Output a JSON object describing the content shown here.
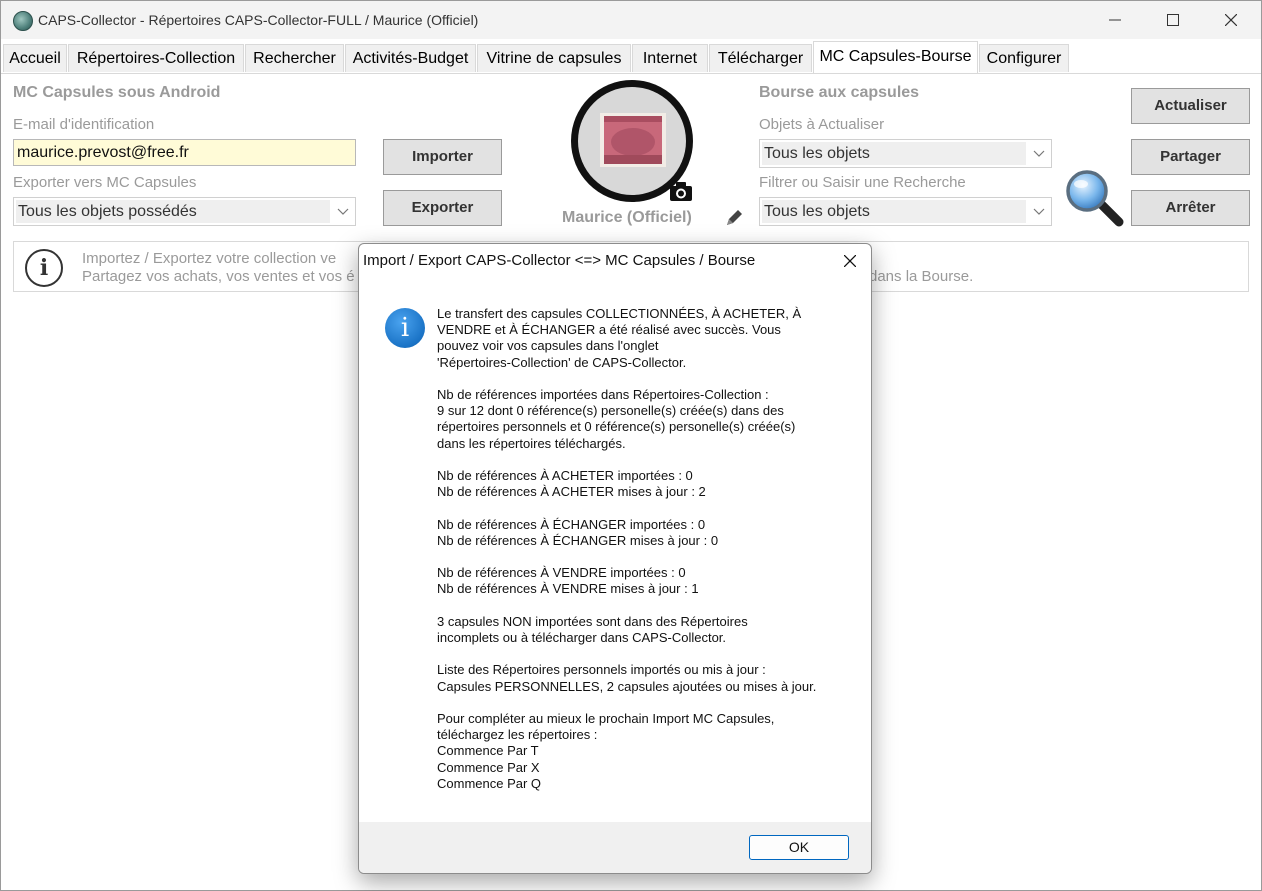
{
  "window": {
    "title": "CAPS-Collector - Répertoires CAPS-Collector-FULL / Maurice (Officiel)"
  },
  "tabs": [
    {
      "label": "Accueil"
    },
    {
      "label": "Répertoires-Collection"
    },
    {
      "label": "Rechercher"
    },
    {
      "label": "Activités-Budget"
    },
    {
      "label": "Vitrine de capsules"
    },
    {
      "label": "Internet"
    },
    {
      "label": "Télécharger"
    },
    {
      "label": "MC Capsules-Bourse",
      "active": true
    },
    {
      "label": "Configurer"
    }
  ],
  "left": {
    "heading": "MC Capsules sous Android",
    "email_label": "E-mail d'identification",
    "email_value": "maurice.prevost@free.fr",
    "export_label": "Exporter vers MC Capsules",
    "export_value": "Tous les objets possédés"
  },
  "buttons": {
    "import": "Importer",
    "export": "Exporter",
    "refresh": "Actualiser",
    "share": "Partager",
    "stop": "Arrêter"
  },
  "user": {
    "name": "Maurice (Officiel)"
  },
  "right": {
    "heading": "Bourse aux capsules",
    "objects_label": "Objets à Actualiser",
    "objects_value": "Tous les objets",
    "filter_label": "Filtrer ou Saisir une Recherche",
    "filter_value": "Tous les objets"
  },
  "info": {
    "line1": "Importez  / Exportez votre collection ve",
    "line2": "Partagez vos achats, vos ventes et vos é",
    "line2_tail": "dans la Bourse."
  },
  "dialog": {
    "title": "Import / Export CAPS-Collector <=> MC Capsules / Bourse",
    "paragraphs": [
      "Le transfert des capsules COLLECTIONNÉES, À ACHETER, À\nVENDRE et À ÉCHANGER a été réalisé avec succès. Vous\npouvez voir vos capsules dans l'onglet\n'Répertoires-Collection' de CAPS-Collector.",
      "Nb de références importées dans Répertoires-Collection :\n9 sur 12 dont 0 référence(s) personelle(s) créée(s) dans des\nrépertoires personnels et 0 référence(s) personelle(s) créée(s)\ndans les répertoires téléchargés.",
      "Nb de références À ACHETER importées : 0\nNb de références À ACHETER mises à jour : 2",
      "Nb de références À ÉCHANGER importées : 0\nNb de références À ÉCHANGER mises à jour : 0",
      "Nb de références À VENDRE importées : 0\nNb de références À VENDRE mises à jour : 1",
      "3 capsules NON importées sont dans des Répertoires\nincomplets ou à télécharger dans CAPS-Collector.",
      "Liste des Répertoires personnels importés ou mis à jour :\nCapsules PERSONNELLES, 2 capsules ajoutées ou mises à jour.",
      "Pour compléter au mieux le prochain Import MC Capsules,\ntéléchargez les répertoires :\nCommence Par T\nCommence Par X\nCommence Par Q"
    ],
    "ok_label": "OK"
  },
  "colors": {
    "accent": "#0067c0",
    "email_bg": "#fffbd7",
    "info_icon": "#1a73c6"
  },
  "icons": [
    "app-icon",
    "minimize-icon",
    "maximize-icon",
    "close-icon",
    "camera-icon",
    "pencil-icon",
    "magnifier-icon",
    "info-icon",
    "dialog-info-icon",
    "dialog-close-icon",
    "chevron-down-icon"
  ]
}
